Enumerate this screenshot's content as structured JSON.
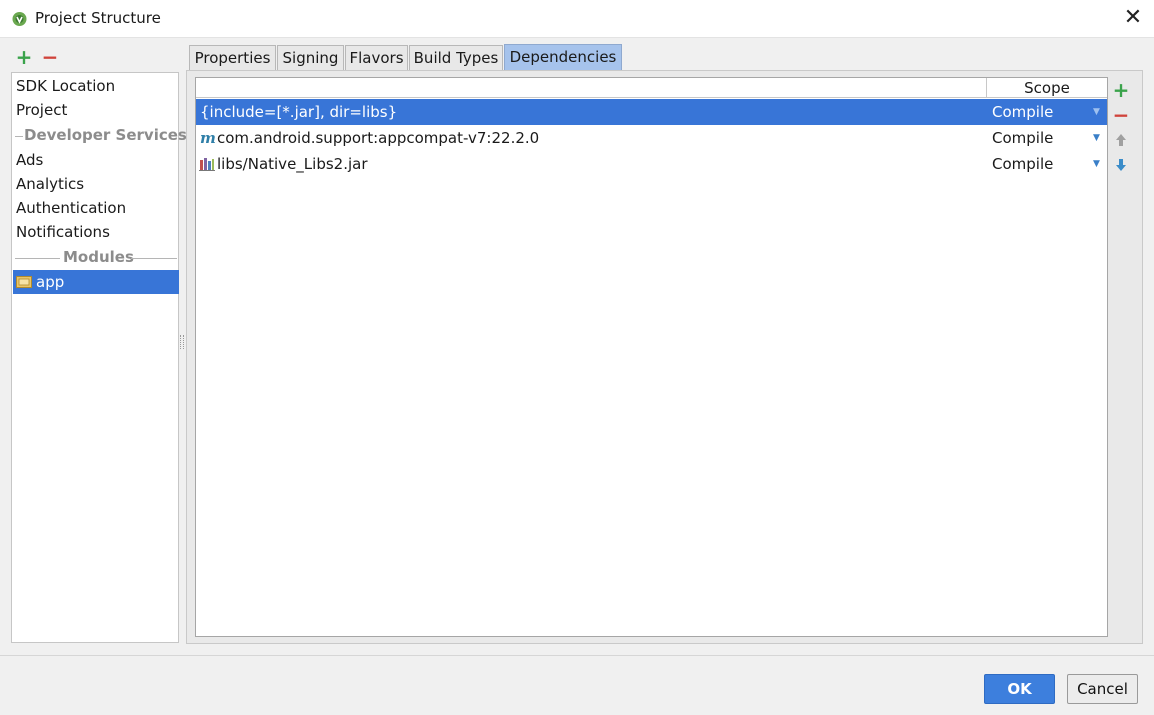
{
  "window": {
    "title": "Project Structure",
    "close_glyph": "✕"
  },
  "left_toolbar": {
    "add_glyph": "+",
    "remove_glyph": "−"
  },
  "sidebar": {
    "items_top": [
      {
        "label": "SDK Location"
      },
      {
        "label": "Project"
      }
    ],
    "developer_services_header": "Developer Services",
    "items_services": [
      {
        "label": "Ads"
      },
      {
        "label": "Analytics"
      },
      {
        "label": "Authentication"
      },
      {
        "label": "Notifications"
      }
    ],
    "modules_header": "Modules",
    "modules": [
      {
        "label": "app",
        "selected": true
      }
    ]
  },
  "tabs": [
    {
      "label": "Properties",
      "active": false
    },
    {
      "label": "Signing",
      "active": false
    },
    {
      "label": "Flavors",
      "active": false
    },
    {
      "label": "Build Types",
      "active": false
    },
    {
      "label": "Dependencies",
      "active": true
    }
  ],
  "dependencies": {
    "columns": [
      "",
      "Scope"
    ],
    "rows": [
      {
        "name": "{include=[*.jar], dir=libs}",
        "scope": "Compile",
        "icon": "none",
        "selected": true
      },
      {
        "name": "com.android.support:appcompat-v7:22.2.0",
        "scope": "Compile",
        "icon": "maven-icon",
        "selected": false
      },
      {
        "name": "libs/Native_Libs2.jar",
        "scope": "Compile",
        "icon": "jar-library-icon",
        "selected": false
      }
    ]
  },
  "right_toolbar": {
    "add_glyph": "+",
    "remove_glyph": "−",
    "up_glyph": "🡅",
    "down_glyph": "🡇"
  },
  "buttons": {
    "ok": "OK",
    "cancel": "Cancel"
  },
  "colors": {
    "selection": "#3875d7",
    "add_green": "#3aa34b",
    "remove_red": "#d0433b",
    "active_tab": "#a6c3ec",
    "ok_button": "#3d7fdd"
  }
}
